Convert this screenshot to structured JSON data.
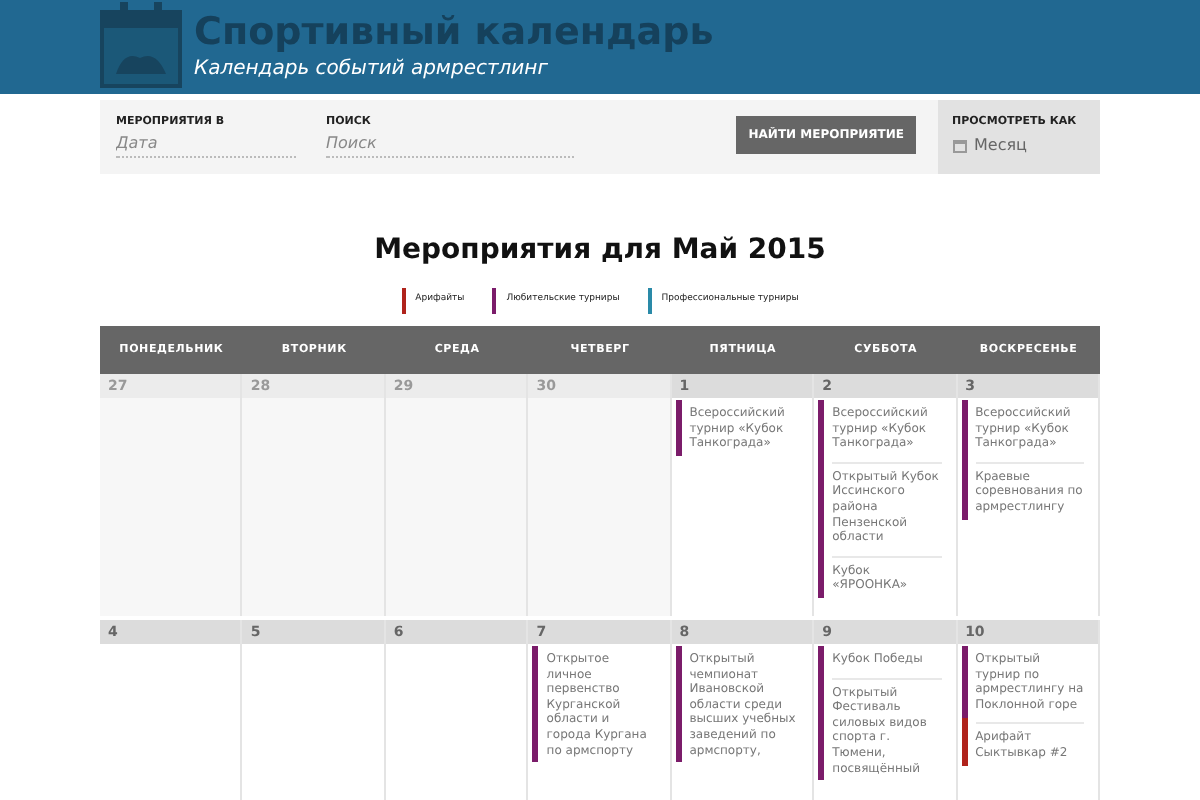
{
  "header": {
    "title": "Спортивный календарь",
    "subtitle": "Календарь событий армрестлинг"
  },
  "filters": {
    "date_label": "МЕРОПРИЯТИЯ В",
    "date_placeholder": "Дата",
    "search_label": "ПОИСК",
    "search_placeholder": "Поиск",
    "find_button": "НАЙТИ МЕРОПРИЯТИЕ",
    "view_label": "ПРОСМОТРЕТЬ КАК",
    "view_value": "Месяц"
  },
  "heading": "Мероприятия для Май 2015",
  "legend": [
    {
      "label": "Арифайты",
      "color": "#b0231c"
    },
    {
      "label": "Любительские турниры",
      "color": "#7b1c6a"
    },
    {
      "label": "Профессиональные турниры",
      "color": "#2a8aa8"
    }
  ],
  "weekdays": [
    "ПОНЕДЕЛЬНИК",
    "ВТОРНИК",
    "СРЕДА",
    "ЧЕТВЕРГ",
    "ПЯТНИЦА",
    "СУББОТА",
    "ВОСКРЕСЕНЬЕ"
  ],
  "weeks": [
    [
      {
        "day": "27",
        "other_month": true
      },
      {
        "day": "28",
        "other_month": true
      },
      {
        "day": "29",
        "other_month": true
      },
      {
        "day": "30",
        "other_month": true
      },
      {
        "day": "1",
        "other_month": false,
        "events": [
          {
            "title": "Всероссийский турнир «Кубок Танкограда»",
            "color": "#7b1c6a"
          }
        ]
      },
      {
        "day": "2",
        "other_month": false,
        "events": [
          {
            "title": "Всероссийский турнир «Кубок Танкограда»",
            "color": "#7b1c6a"
          },
          {
            "title": "Открытый Кубок Иссинского района Пензенской области",
            "color": "#7b1c6a"
          },
          {
            "title": "Кубок «ЯРООНКА»",
            "color": "#7b1c6a"
          }
        ]
      },
      {
        "day": "3",
        "other_month": false,
        "events": [
          {
            "title": "Всероссийский турнир «Кубок Танкограда»",
            "color": "#7b1c6a"
          },
          {
            "title": "Краевые соревнования по армрестлингу",
            "color": "#7b1c6a"
          }
        ]
      }
    ],
    [
      {
        "day": "4",
        "other_month": false
      },
      {
        "day": "5",
        "other_month": false
      },
      {
        "day": "6",
        "other_month": false
      },
      {
        "day": "7",
        "other_month": false,
        "events": [
          {
            "title": "Открытое личное первенство Курганской области и города Кургана по армспорту",
            "color": "#7b1c6a"
          }
        ]
      },
      {
        "day": "8",
        "other_month": false,
        "events": [
          {
            "title": "Открытый чемпионат Ивановской области среди высших учебных заведений по армспорту,",
            "color": "#7b1c6a"
          }
        ]
      },
      {
        "day": "9",
        "other_month": false,
        "events": [
          {
            "title": "Кубок Победы",
            "color": "#7b1c6a"
          },
          {
            "title": "Открытый Фестиваль силовых видов спорта г. Тюмени, посвящённый",
            "color": "#7b1c6a"
          }
        ]
      },
      {
        "day": "10",
        "other_month": false,
        "events": [
          {
            "title": "Открытый турнир по армрестлингу на Поклонной горе",
            "color": "#7b1c6a"
          },
          {
            "title": "Арифайт Сыктывкар #2",
            "color": "#b0231c"
          }
        ]
      }
    ]
  ]
}
